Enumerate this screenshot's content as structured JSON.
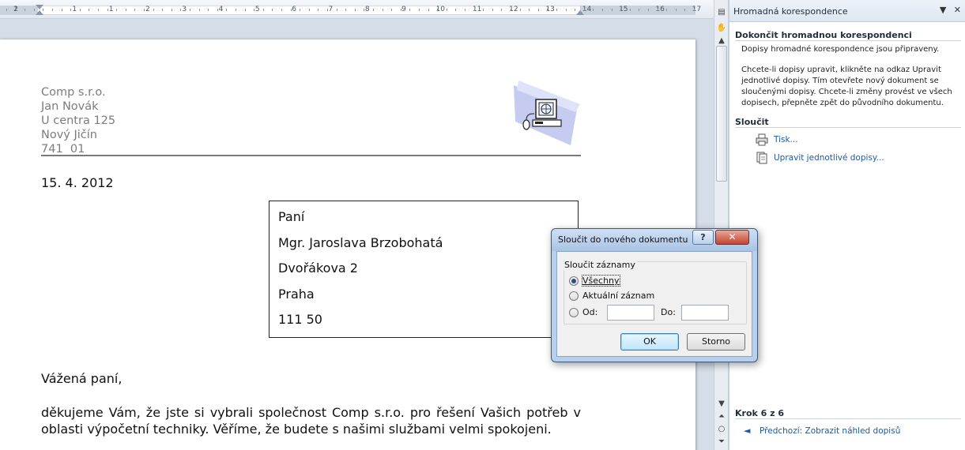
{
  "ruler": {
    "numbers": [
      "1",
      "2",
      "1",
      "1",
      "2",
      "3",
      "4",
      "5",
      "6",
      "7",
      "8",
      "9",
      "10",
      "11",
      "12",
      "13",
      "14",
      "15",
      "16",
      "17"
    ]
  },
  "document": {
    "sender": {
      "company": "Comp s.r.o.",
      "name": "Jan Novák",
      "street": "U centra 125",
      "city": "Nový Jičín",
      "zip": "741  01"
    },
    "date": "15. 4. 2012",
    "recipient": {
      "salutation": "Paní",
      "name": "Mgr. Jaroslava Brzobohatá",
      "street": "Dvořákova 2",
      "city": "Praha",
      "zip": "111 50"
    },
    "greeting": "Vážená paní,",
    "body": "děkujeme Vám, že jste si vybrali společnost Comp s.r.o. pro řešení Vašich potřeb v oblasti výpočetní techniky. Věříme, že budete s našimi službami velmi spokojeni."
  },
  "task_pane": {
    "title": "Hromadná korespondence",
    "section_finish": {
      "heading": "Dokončit hromadnou korespondenci",
      "ready_text": "Dopisy hromadné korespondence jsou připraveny.",
      "instructions": "Chcete-li dopisy upravit, klikněte na odkaz Upravit jednotlivé dopisy. Tím otevřete nový dokument se sloučenými dopisy. Chcete-li změny provést ve všech dopisech, přepněte zpět do původního dokumentu."
    },
    "section_merge": {
      "heading": "Sloučit",
      "print_link": "Tisk...",
      "edit_link": "Upravit jednotlivé dopisy..."
    },
    "step": {
      "label": "Krok 6 z 6",
      "prev_link": "Předchozí: Zobrazit náhled dopisů"
    }
  },
  "dialog": {
    "title": "Sloučit do nového dokumentu",
    "help_label": "?",
    "close_label": "✕",
    "group_title": "Sloučit záznamy",
    "radio_all": "Všechny",
    "radio_current": "Aktuální záznam",
    "radio_from": "Od:",
    "to_label": "Do:",
    "from_value": "",
    "to_value": "",
    "ok_label": "OK",
    "cancel_label": "Storno",
    "selected_option": "Všechny"
  },
  "colors": {
    "link": "#1a5aa8",
    "close_button": "#c4452f",
    "dialog_frame": "#b9d0ec",
    "sender_text": "#7c7c7c"
  }
}
